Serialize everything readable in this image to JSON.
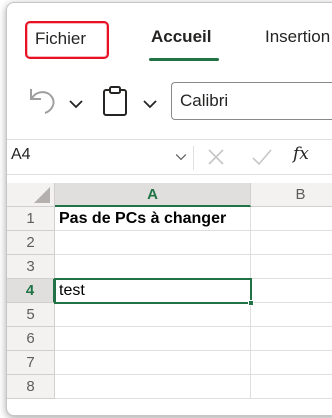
{
  "ribbon": {
    "tabs": [
      {
        "label": "Fichier"
      },
      {
        "label": "Accueil"
      },
      {
        "label": "Insertion"
      }
    ]
  },
  "toolbar": {
    "font_name": "Calibri"
  },
  "formula_bar": {
    "name_box": "A4",
    "fx_label": "fx"
  },
  "grid": {
    "columns": [
      "A",
      "B"
    ],
    "rows": [
      "1",
      "2",
      "3",
      "4",
      "5",
      "6",
      "7",
      "8"
    ],
    "cells": {
      "A1": "Pas de PCs à changer",
      "A4": "test"
    },
    "active_cell": "A4"
  },
  "colors": {
    "accent": "#217346",
    "highlight_border": "#e81123"
  }
}
